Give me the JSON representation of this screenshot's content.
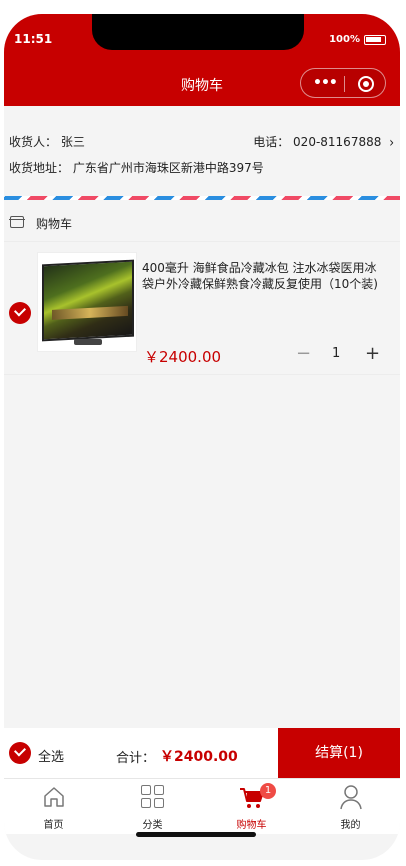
{
  "status_bar": {
    "time": "11:51",
    "battery": "100%"
  },
  "nav": {
    "title": "购物车"
  },
  "address": {
    "receiver_label": "收货人：",
    "receiver_name": "张三",
    "phone_label": "电话：",
    "phone": "020-81167888",
    "address_label": "收货地址：",
    "address": "广东省广州市海珠区新港中路397号"
  },
  "cart": {
    "header_title": "购物车",
    "items": [
      {
        "title": "400毫升 海鲜食品冷藏冰包 注水冰袋医用冰袋户外冷藏保鲜熟食冷藏反复使用（10个装)",
        "price": "￥2400.00",
        "quantity": "1",
        "minus_label": "−",
        "plus_label": "+",
        "image_icon": "tv-image"
      }
    ]
  },
  "footer": {
    "select_all_label": "全选",
    "total_label": "合计：",
    "total_value": "￥2400.00",
    "checkout_label": "结算(1)"
  },
  "tabbar": {
    "items": [
      {
        "label": "首页",
        "icon": "home-icon"
      },
      {
        "label": "分类",
        "icon": "category-icon"
      },
      {
        "label": "购物车",
        "icon": "cart-icon",
        "badge": "1",
        "active": true
      },
      {
        "label": "我的",
        "icon": "user-icon"
      }
    ]
  },
  "colors": {
    "brand_red": "#c70000",
    "background": "#f4f4f4",
    "badge_red": "#ef4b45"
  }
}
